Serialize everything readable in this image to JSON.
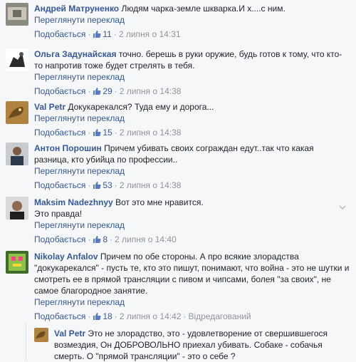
{
  "ui": {
    "translate_label": "Переглянути переклад",
    "like_label": "Подобається",
    "edited_label": "Відредагований",
    "dot": "·"
  },
  "comments": [
    {
      "author": "Андрей Матруненко",
      "text": "Людям чарка-земле шкварка.И х....с ним.",
      "likes": "11",
      "time": "2 липня о 14:31"
    },
    {
      "author": "Ольга Задунайская",
      "text": "точно. берешь в руки оружие, будь готов к тому, что кто-то напротив тоже будет стрелять в тебя.",
      "likes": "29",
      "time": "2 липня о 14:38"
    },
    {
      "author": "Val Petr",
      "text": "Докукарекался? Туда ему и дорога...",
      "likes": "15",
      "time": "2 липня о 14:38"
    },
    {
      "author": "Антон Порошин",
      "text": "Причем убивать своих сограждан едут..так что какая разница, кто убийца по профессии..",
      "likes": "53",
      "time": "2 липня о 14:38"
    },
    {
      "author": "Maksim Nadezhnyy",
      "text": "Вот это мне нравится.",
      "text2": "Это правда!",
      "likes": "8",
      "time": "2 липня о 14:40"
    },
    {
      "author": "Nikolay Anfalov",
      "text": "Причем по обе стороны. А про всякие злорадства \"докукарекался\" - пусть те, кто это пишут, понимают, что война - это не шутки и смотреть ее в прямой трансляции с пивом и чипсами, болея \"за своих\", не самое благородное занятие.",
      "likes": "18",
      "time": "2 липня о 14:42"
    },
    {
      "author": "Val Petr",
      "text": "Это не злорадство, это - удовлетворение от свершившегося возмездия, Он ДОБРОВОЛЬНО приехал убивать. Собаке - собачья смерть. О \"прямой трансляции\" - это о себе ?"
    }
  ],
  "colors": {
    "link": "#365899",
    "meta": "#90949c",
    "text": "#1d2129",
    "background": "#f6f7f9"
  },
  "icons": {
    "like": "thumbs-up-icon",
    "menu": "chevron-down-icon"
  }
}
